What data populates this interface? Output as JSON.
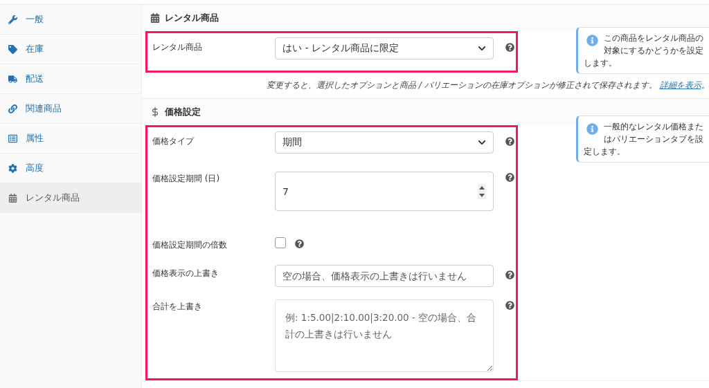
{
  "sidebar": {
    "items": [
      {
        "label": "一般",
        "selected": false
      },
      {
        "label": "在庫",
        "selected": false
      },
      {
        "label": "配送",
        "selected": false
      },
      {
        "label": "関連商品",
        "selected": false
      },
      {
        "label": "属性",
        "selected": false
      },
      {
        "label": "高度",
        "selected": false
      },
      {
        "label": "レンタル商品",
        "selected": true
      }
    ]
  },
  "sections": [
    {
      "title": "レンタル商品",
      "note": "この商品をレンタル商品の対象にするかどうかを設定します。",
      "fields": [
        {
          "kind": "select",
          "label": "レンタル商品",
          "value": "はい - レンタル商品に限定"
        }
      ],
      "description": "変更すると、選択したオプションと商品 / バリエーションの在庫オプションが修正されて保存されます。",
      "link": "詳細を表示",
      "after_link": "。"
    },
    {
      "title": "価格設定",
      "note": "一般的なレンタル価格またはバリエーションタブを設定します。",
      "fields": [
        {
          "kind": "select",
          "label": "価格タイプ",
          "value": "期間"
        },
        {
          "kind": "number",
          "label": "価格設定期間 (日)",
          "value": "7"
        },
        {
          "kind": "checkbox",
          "label": "価格設定期間の倍数",
          "checked": false
        },
        {
          "kind": "text",
          "label": "価格表示の上書き",
          "placeholder": "空の場合、価格表示の上書きは行いません"
        },
        {
          "kind": "textarea",
          "label": "合計を上書き",
          "placeholder": "例: 1:5.00|2:10.00|3:20.00 - 空の場合、合計の上書きは行いません"
        }
      ]
    }
  ]
}
